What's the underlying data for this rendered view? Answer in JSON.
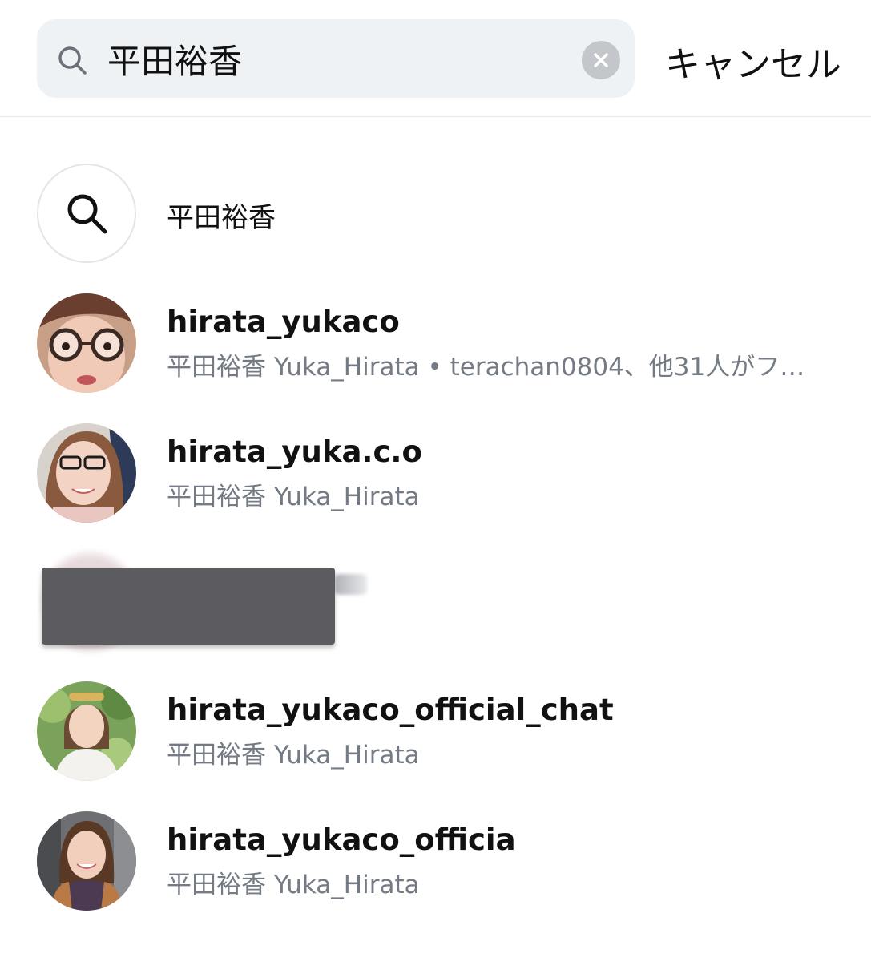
{
  "search": {
    "value": "平田裕香",
    "cancel_label": "キャンセル"
  },
  "query_suggestion": {
    "text": "平田裕香",
    "icon": "search-icon"
  },
  "results": [
    {
      "username": "hirata_yukaco",
      "subtitle": "平田裕香 Yuka_Hirata • terachan0804、他31人がフ…"
    },
    {
      "username": "hirata_yuka.c.o",
      "subtitle": "平田裕香 Yuka_Hirata"
    },
    {
      "username": "",
      "subtitle": ""
    },
    {
      "username": "hirata_yukaco_official_chat",
      "subtitle": "平田裕香 Yuka_Hirata"
    },
    {
      "username": "hirata_yukaco_officia",
      "subtitle": "平田裕香 Yuka_Hirata"
    }
  ],
  "colors": {
    "search_bg": "#eff2f5",
    "secondary_text": "#747b84",
    "redaction": "#5c5c60"
  }
}
